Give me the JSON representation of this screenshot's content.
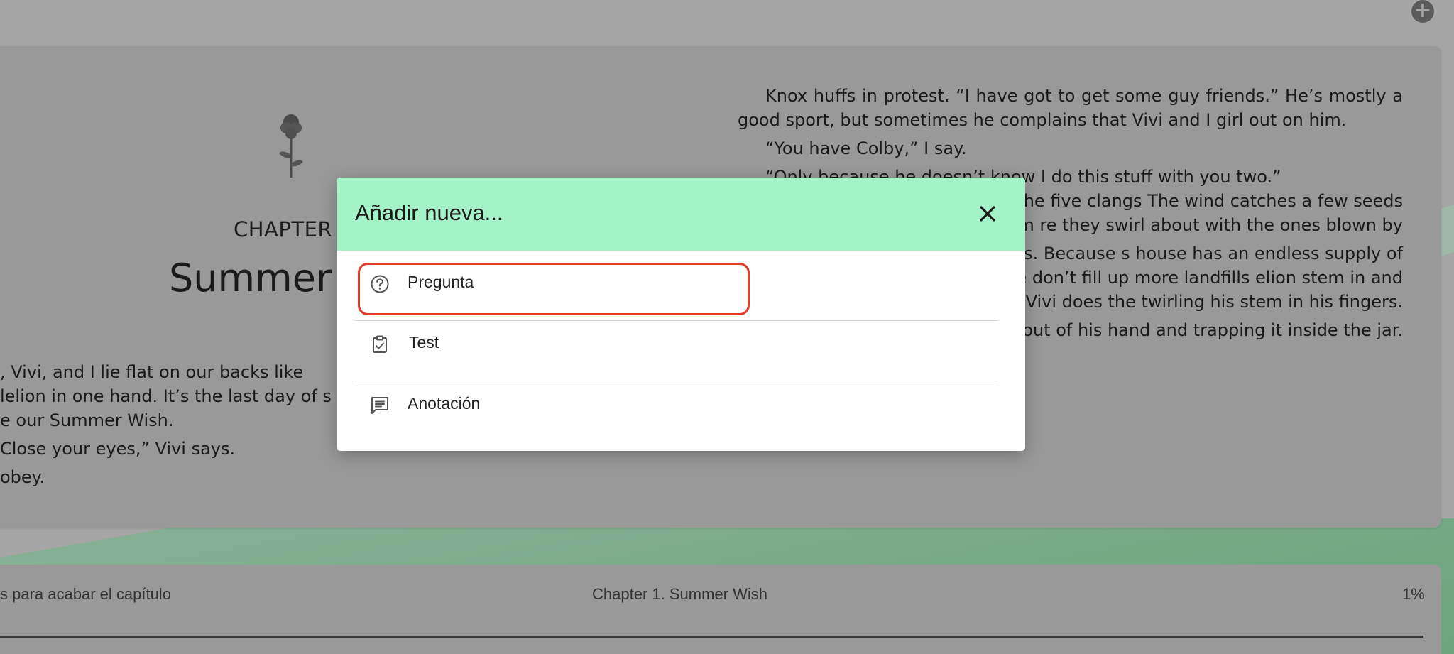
{
  "header": {
    "add_icon": "plus-circle-icon"
  },
  "book": {
    "chapter_label": "CHAPTER",
    "chapter_title": "Summer W",
    "left_lines": [
      ", Vivi, and I lie flat on our backs like",
      "lelion in one hand. It’s the last day of s",
      "e our Summer Wish.",
      "Close your eyes,” Vivi says.",
      "obey."
    ],
    "right_paragraphs": [
      "Knox huffs in protest. “I have got to get some guy friends.” He’s mostly a good sport, but sometimes he complains that Vivi and I girl out on him.",
      "“You have Colby,” I say.",
      "“Only because he doesn’t know I do this stuff with you two.”",
      "wer tolls. When the last of the five clangs The wind catches a few seeds and lifts them re they swirl about with the ones blown by",
      "and tosses empty containers to us. Because s house has an endless supply of baby food mmer ritual so we don’t fill up more landfills elion stem in and twist the lid. Vivi does the twirling his stem in his fingers.",
      "cking the dandelion out of his hand and trapping it inside the jar."
    ]
  },
  "footer": {
    "remaining": "s para acabar el capítulo",
    "chapter_name": "Chapter 1. Summer Wish",
    "percent": "1%",
    "progress": 0.01
  },
  "modal": {
    "title": "Añadir nueva...",
    "close_icon": "close-icon",
    "options": [
      {
        "label": "Pregunta",
        "icon": "question-circle-icon"
      },
      {
        "label": "Test",
        "icon": "clipboard-check-icon"
      },
      {
        "label": "Anotación",
        "icon": "comment-lines-icon"
      }
    ]
  }
}
